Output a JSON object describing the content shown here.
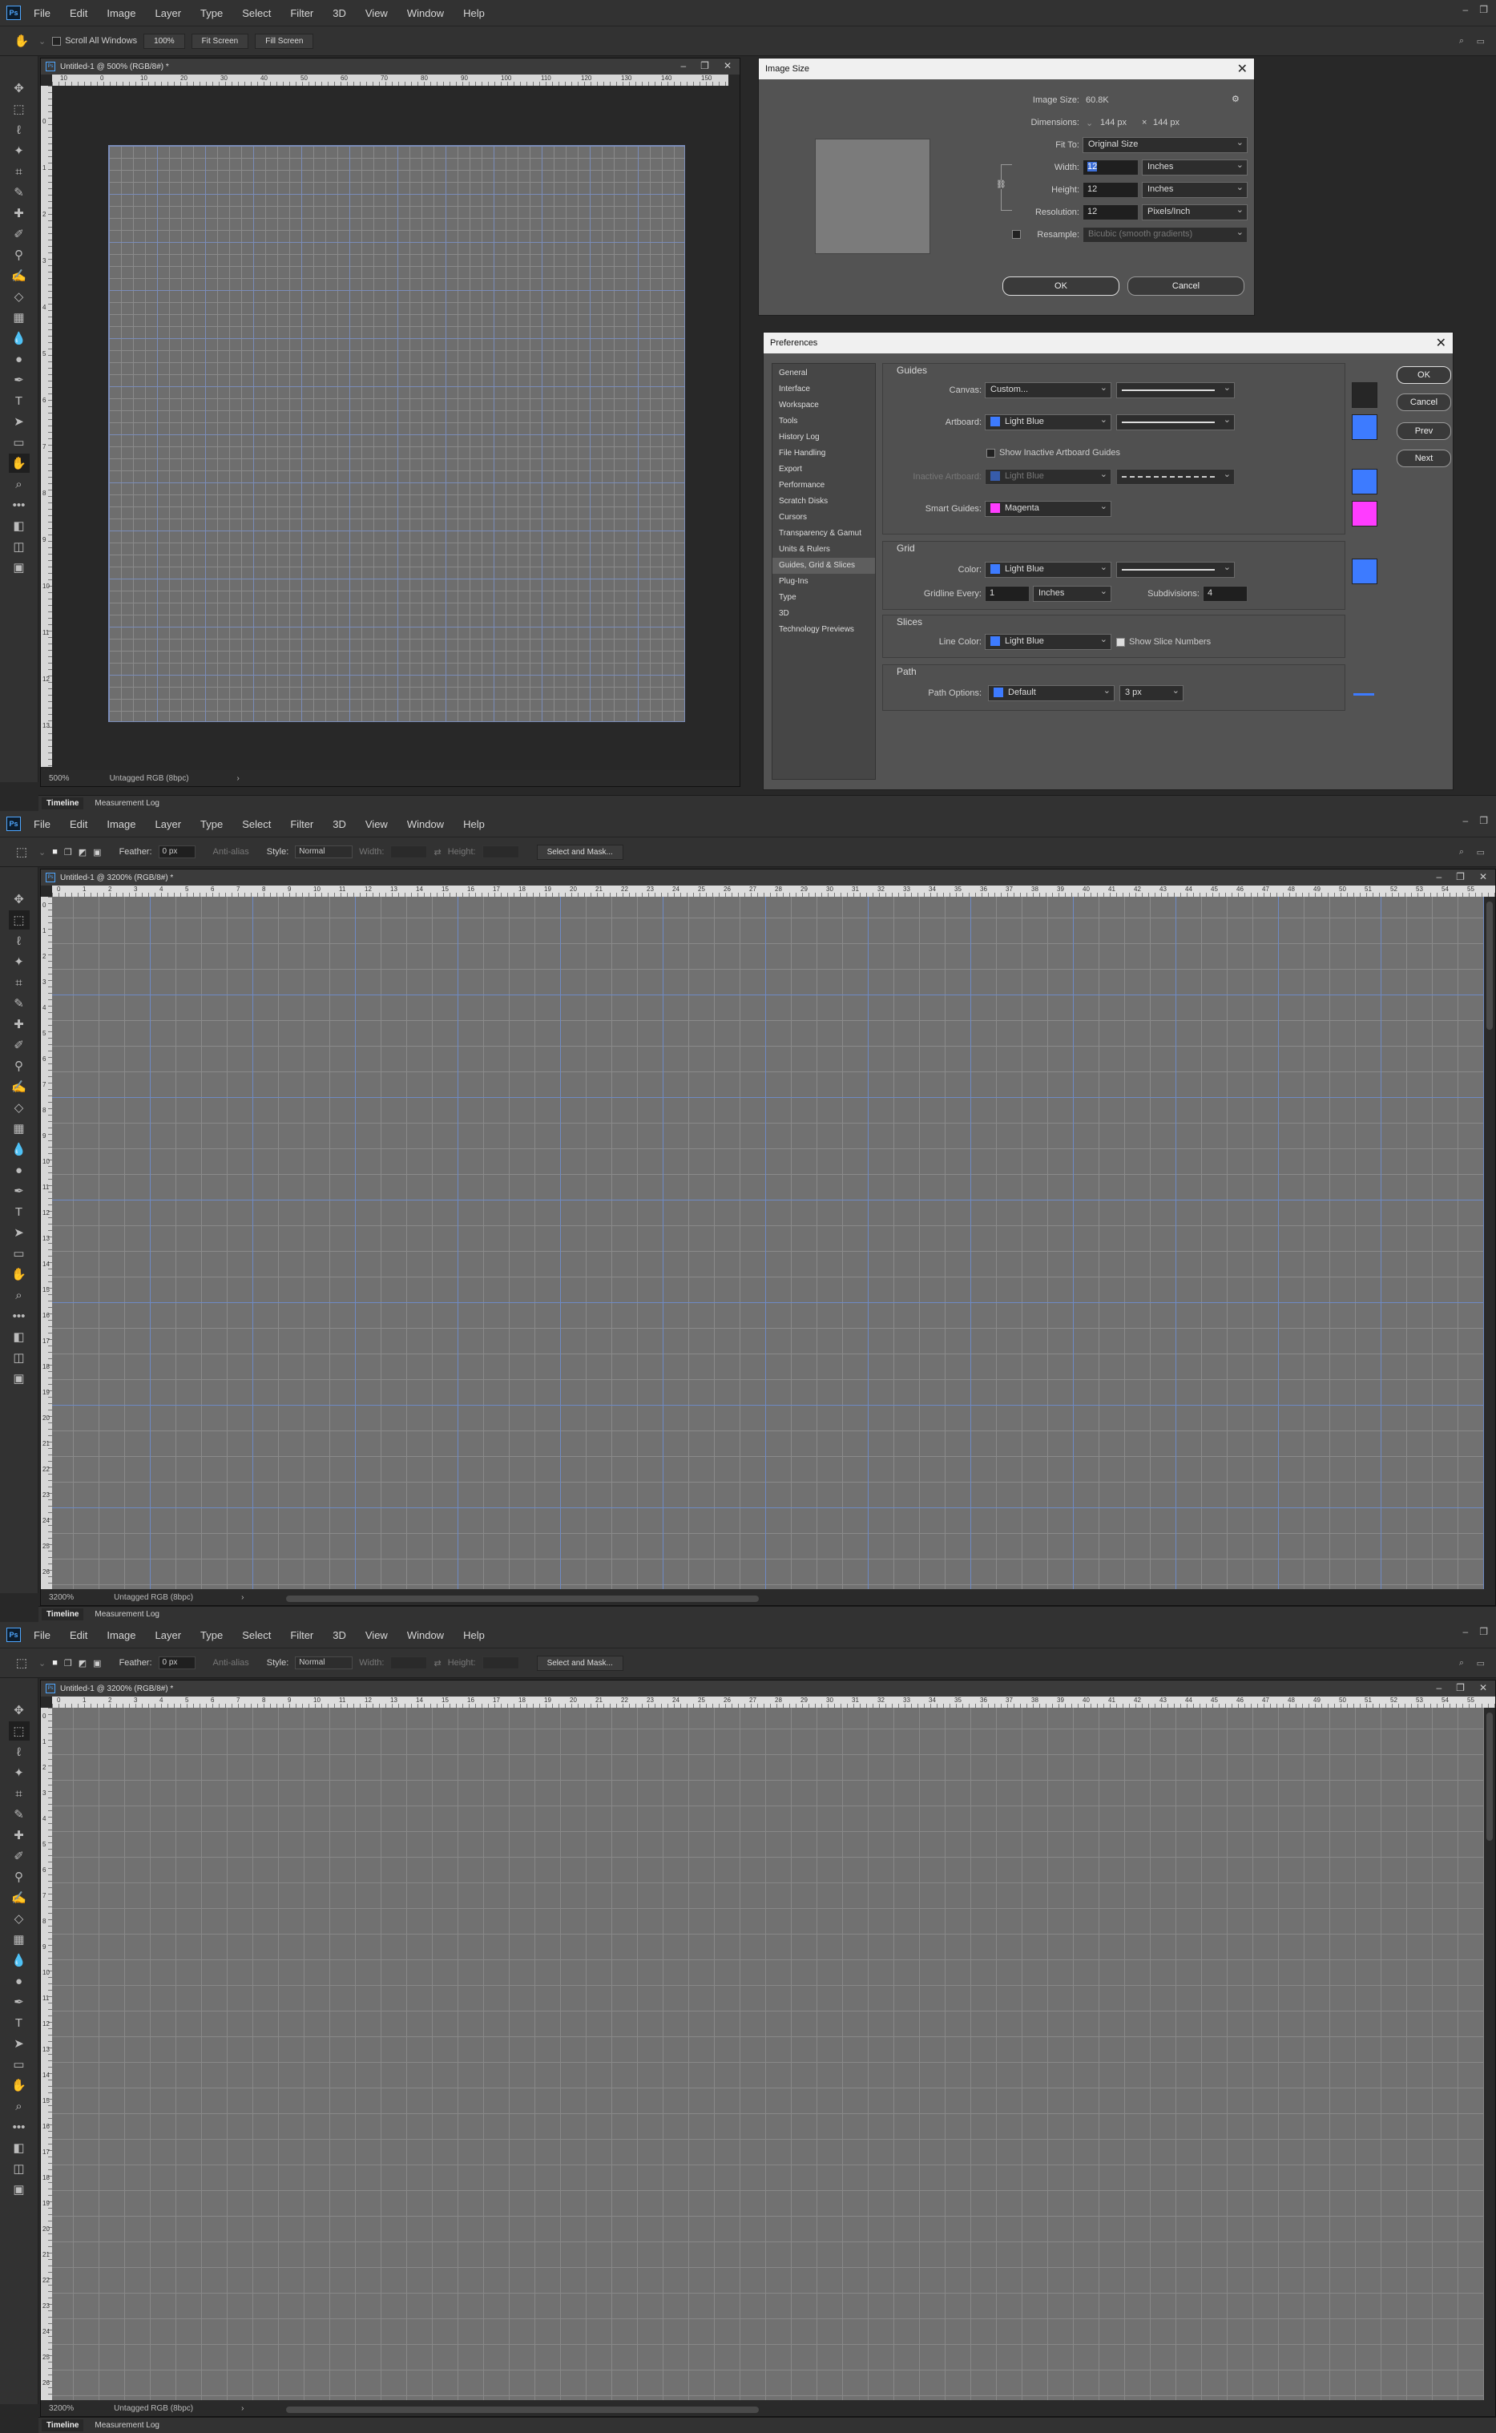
{
  "menu": [
    "File",
    "Edit",
    "Image",
    "Layer",
    "Type",
    "Select",
    "Filter",
    "3D",
    "View",
    "Window",
    "Help"
  ],
  "logo": "Ps",
  "panel1": {
    "options": {
      "scroll_all": "Scroll All Windows",
      "zoom": "100%",
      "fit_screen": "Fit Screen",
      "fill_screen": "Fill Screen"
    },
    "doc_title": "Untitled-1 @ 500% (RGB/8#) *",
    "ruler_top": [
      "10",
      "0",
      "10",
      "20",
      "30",
      "40",
      "50",
      "60",
      "70",
      "80",
      "90",
      "100",
      "110",
      "120",
      "130",
      "140",
      "150"
    ],
    "ruler_left": [
      "0",
      "1",
      "2",
      "3",
      "4",
      "5",
      "6",
      "7",
      "8",
      "9",
      "10",
      "11",
      "12",
      "13",
      "14"
    ],
    "status_zoom": "500%",
    "status_profile": "Untagged RGB (8bpc)",
    "image_size": {
      "title": "Image Size",
      "image_size_label": "Image Size:",
      "image_size_value": "60.8K",
      "dimensions_label": "Dimensions:",
      "dim_w": "144 px",
      "dim_x": "×",
      "dim_h": "144 px",
      "fit_to_label": "Fit To:",
      "fit_to": "Original Size",
      "width_label": "Width:",
      "width": "12",
      "width_unit": "Inches",
      "height_label": "Height:",
      "height": "12",
      "height_unit": "Inches",
      "resolution_label": "Resolution:",
      "resolution": "12",
      "resolution_unit": "Pixels/Inch",
      "resample_label": "Resample:",
      "resample": "Bicubic (smooth gradients)",
      "ok": "OK",
      "cancel": "Cancel"
    },
    "prefs": {
      "title": "Preferences",
      "nav": [
        "General",
        "Interface",
        "Workspace",
        "Tools",
        "History Log",
        "File Handling",
        "Export",
        "Performance",
        "Scratch Disks",
        "Cursors",
        "Transparency & Gamut",
        "Units & Rulers",
        "Guides, Grid & Slices",
        "Plug-Ins",
        "Type",
        "3D",
        "Technology Previews"
      ],
      "guides_title": "Guides",
      "canvas_label": "Canvas:",
      "canvas": "Custom...",
      "artboard_label": "Artboard:",
      "artboard": "Light Blue",
      "show_inactive": "Show Inactive Artboard Guides",
      "inactive_label": "Inactive Artboard:",
      "inactive": "Light Blue",
      "smart_label": "Smart Guides:",
      "smart": "Magenta",
      "grid_title": "Grid",
      "grid_color_label": "Color:",
      "grid_color": "Light Blue",
      "gridline_label": "Gridline Every:",
      "gridline": "1",
      "gridline_unit": "Inches",
      "subdiv_label": "Subdivisions:",
      "subdiv": "4",
      "slices_title": "Slices",
      "line_color_label": "Line Color:",
      "line_color": "Light Blue",
      "show_slice": "Show Slice Numbers",
      "path_title": "Path",
      "path_label": "Path Options:",
      "path": "Default",
      "path_px": "3 px",
      "ok": "OK",
      "cancel": "Cancel",
      "prev": "Prev",
      "next": "Next"
    }
  },
  "panel2": {
    "options": {
      "feather_label": "Feather:",
      "feather": "0 px",
      "antialias": "Anti-alias",
      "style_label": "Style:",
      "style": "Normal",
      "width_label": "Width:",
      "height_label": "Height:",
      "select_mask": "Select and Mask..."
    },
    "doc_title": "Untitled-1 @ 3200% (RGB/8#) *",
    "status_zoom": "3200%",
    "status_profile": "Untagged RGB (8bpc)"
  },
  "panel3": {
    "options": {
      "feather_label": "Feather:",
      "feather": "0 px",
      "antialias": "Anti-alias",
      "style_label": "Style:",
      "style": "Normal",
      "width_label": "Width:",
      "height_label": "Height:",
      "select_mask": "Select and Mask..."
    },
    "doc_title": "Untitled-1 @ 3200% (RGB/8#) *",
    "status_zoom": "3200%",
    "status_profile": "Untagged RGB (8bpc)"
  },
  "ruler_big": [
    "0",
    "1",
    "2",
    "3",
    "4",
    "5",
    "6",
    "7",
    "8",
    "9",
    "10",
    "11",
    "12",
    "13",
    "14",
    "15",
    "16",
    "17",
    "18",
    "19",
    "20",
    "21",
    "22",
    "23",
    "24",
    "25",
    "26",
    "27",
    "28",
    "29",
    "30",
    "31",
    "32",
    "33",
    "34",
    "35",
    "36",
    "37",
    "38",
    "39",
    "40",
    "41",
    "42",
    "43",
    "44",
    "45",
    "46",
    "47",
    "48",
    "49",
    "50",
    "51",
    "52",
    "53",
    "54",
    "55"
  ],
  "ruler_big_left": [
    "0",
    "1",
    "2",
    "3",
    "4",
    "5",
    "6",
    "7",
    "8",
    "9",
    "10",
    "11",
    "12",
    "13",
    "14",
    "15",
    "16",
    "17",
    "18",
    "19",
    "20",
    "21",
    "22",
    "23",
    "24",
    "25",
    "26"
  ],
  "timeline": {
    "tab1": "Timeline",
    "tab2": "Measurement Log"
  },
  "colors": {
    "light_blue": "#3d7bff",
    "magenta": "#ff3cff",
    "swatch_dark": "#262626"
  }
}
